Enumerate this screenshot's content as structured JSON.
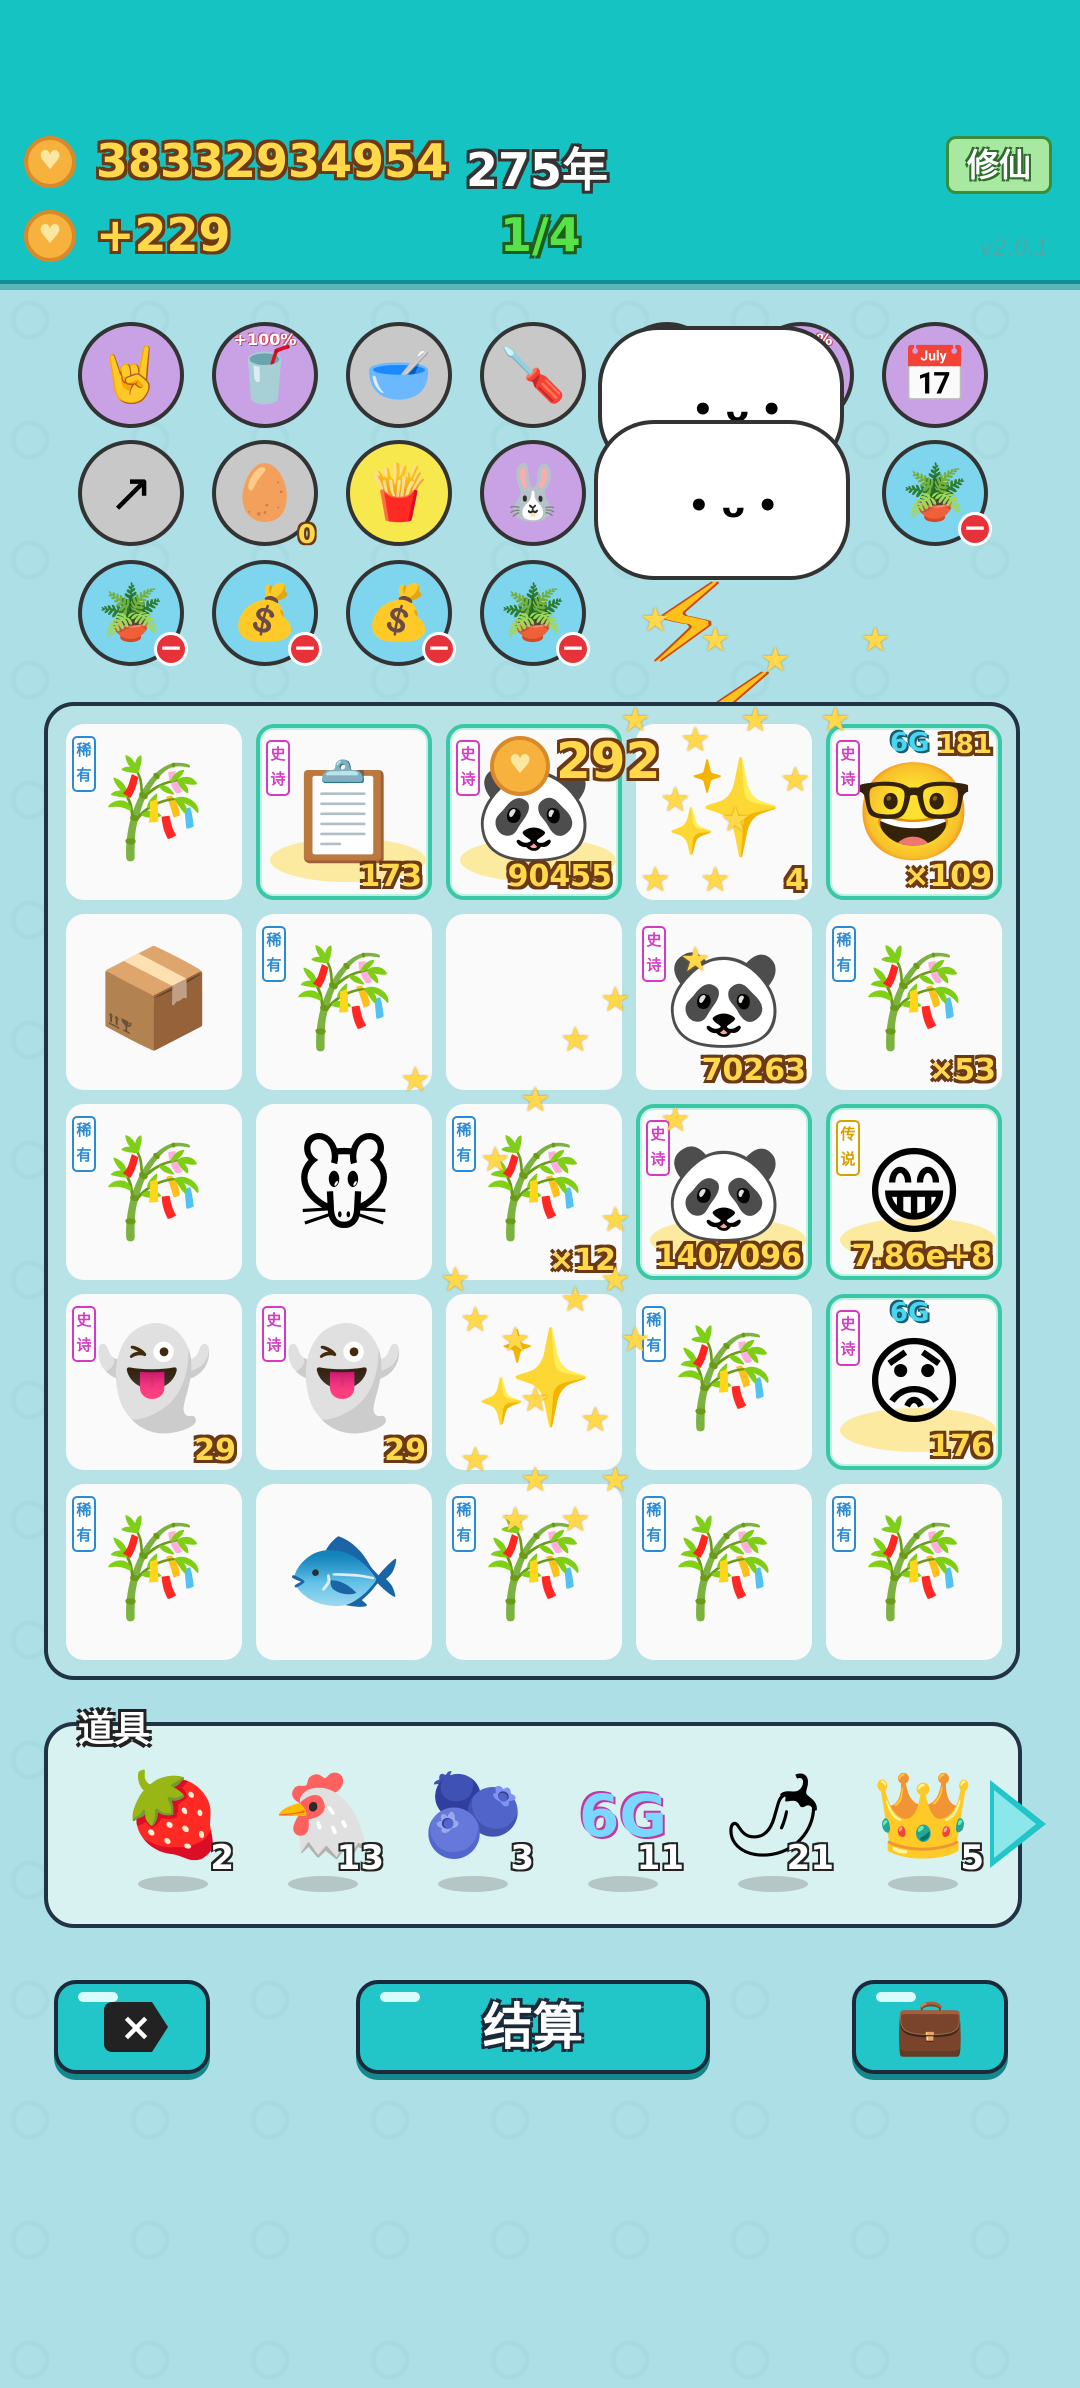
{
  "header": {
    "coins": "38332934954",
    "income": "+229",
    "year": "275年",
    "progress": "1/4",
    "xiuxian_label": "修仙",
    "version": "v2.0.1"
  },
  "relics": [
    {
      "icon": "🤘",
      "bg": "#c9a2e6"
    },
    {
      "icon": "🥤",
      "bg": "#c9a2e6",
      "label": "+100%"
    },
    {
      "icon": "🥣",
      "bg": "#c8c8c8"
    },
    {
      "icon": "🪛",
      "bg": "#c8c8c8"
    },
    {
      "icon": "",
      "bg": "#c8c8c8"
    },
    {
      "icon": "",
      "bg": "#c9a2e6",
      "label": "+100%"
    },
    {
      "icon": "📅",
      "bg": "#c9a2e6"
    },
    {
      "icon": "↗",
      "bg": "#c8c8c8"
    },
    {
      "icon": "🥚",
      "bg": "#c8c8c8",
      "small": "0"
    },
    {
      "icon": "🍟",
      "bg": "#f7e84e"
    },
    {
      "icon": "🐰",
      "bg": "#c9a2e6"
    },
    {
      "icon": "🪴",
      "bg": "#7ed6ee",
      "minus": true
    },
    {
      "icon": "🪴",
      "bg": "#7ed6ee",
      "minus": true
    },
    {
      "icon": "💰",
      "bg": "#7ed6ee",
      "minus": true
    },
    {
      "icon": "💰",
      "bg": "#7ed6ee",
      "minus": true
    },
    {
      "icon": "🪴",
      "bg": "#7ed6ee",
      "minus": true
    }
  ],
  "board": [
    {
      "tag": "稀有",
      "tagType": "rare",
      "icon": "🎋"
    },
    {
      "tag": "史诗",
      "tagType": "epic",
      "icon": "📋",
      "count": "173",
      "epic": true
    },
    {
      "tag": "史诗",
      "tagType": "epic",
      "icon": "🐼",
      "count": "90455",
      "epic": true
    },
    {
      "tag": "",
      "tagType": "",
      "icon": "✨",
      "count": "4"
    },
    {
      "tag": "史诗",
      "tagType": "epic",
      "icon": "🤓",
      "count": "×109",
      "epic": true,
      "lvl": "6G",
      "extra": "181"
    },
    {
      "tag": "",
      "tagType": "",
      "icon": "📦"
    },
    {
      "tag": "稀有",
      "tagType": "rare",
      "icon": "🎋"
    },
    {
      "tag": "",
      "tagType": "",
      "icon": ""
    },
    {
      "tag": "史诗",
      "tagType": "epic",
      "icon": "🐼",
      "count": "70263"
    },
    {
      "tag": "稀有",
      "tagType": "rare",
      "icon": "🎋",
      "count": "×53"
    },
    {
      "tag": "稀有",
      "tagType": "rare",
      "icon": "🎋"
    },
    {
      "tag": "",
      "tagType": "",
      "icon": "🐭"
    },
    {
      "tag": "稀有",
      "tagType": "rare",
      "icon": "🎋",
      "count": "×12"
    },
    {
      "tag": "史诗",
      "tagType": "epic",
      "icon": "🐼",
      "count": "1407096",
      "epic": true
    },
    {
      "tag": "传说",
      "tagType": "legend",
      "icon": "😁",
      "count": "7.86e+8",
      "epic": true
    },
    {
      "tag": "史诗",
      "tagType": "epic",
      "icon": "👻",
      "count": "29"
    },
    {
      "tag": "史诗",
      "tagType": "epic",
      "icon": "👻",
      "count": "29"
    },
    {
      "tag": "",
      "tagType": "",
      "icon": "✨"
    },
    {
      "tag": "稀有",
      "tagType": "rare",
      "icon": "🎋"
    },
    {
      "tag": "史诗",
      "tagType": "epic",
      "icon": "😟",
      "count": "176",
      "epic": true,
      "lvl": "6G"
    },
    {
      "tag": "稀有",
      "tagType": "rare",
      "icon": "🎋"
    },
    {
      "tag": "",
      "tagType": "",
      "icon": "🐟"
    },
    {
      "tag": "稀有",
      "tagType": "rare",
      "icon": "🎋"
    },
    {
      "tag": "稀有",
      "tagType": "rare",
      "icon": "🎋"
    },
    {
      "tag": "稀有",
      "tagType": "rare",
      "icon": "🎋"
    }
  ],
  "floating_coin": "292",
  "items_title": "道具",
  "items": [
    {
      "icon": "🍓",
      "count": "2"
    },
    {
      "icon": "🐔",
      "count": "13"
    },
    {
      "icon": "🫐",
      "count": "3"
    },
    {
      "icon": "6G",
      "count": "11"
    },
    {
      "icon": "🌶",
      "count": "21"
    },
    {
      "icon": "👑",
      "count": "5"
    }
  ],
  "buttons": {
    "settle": "结算"
  }
}
